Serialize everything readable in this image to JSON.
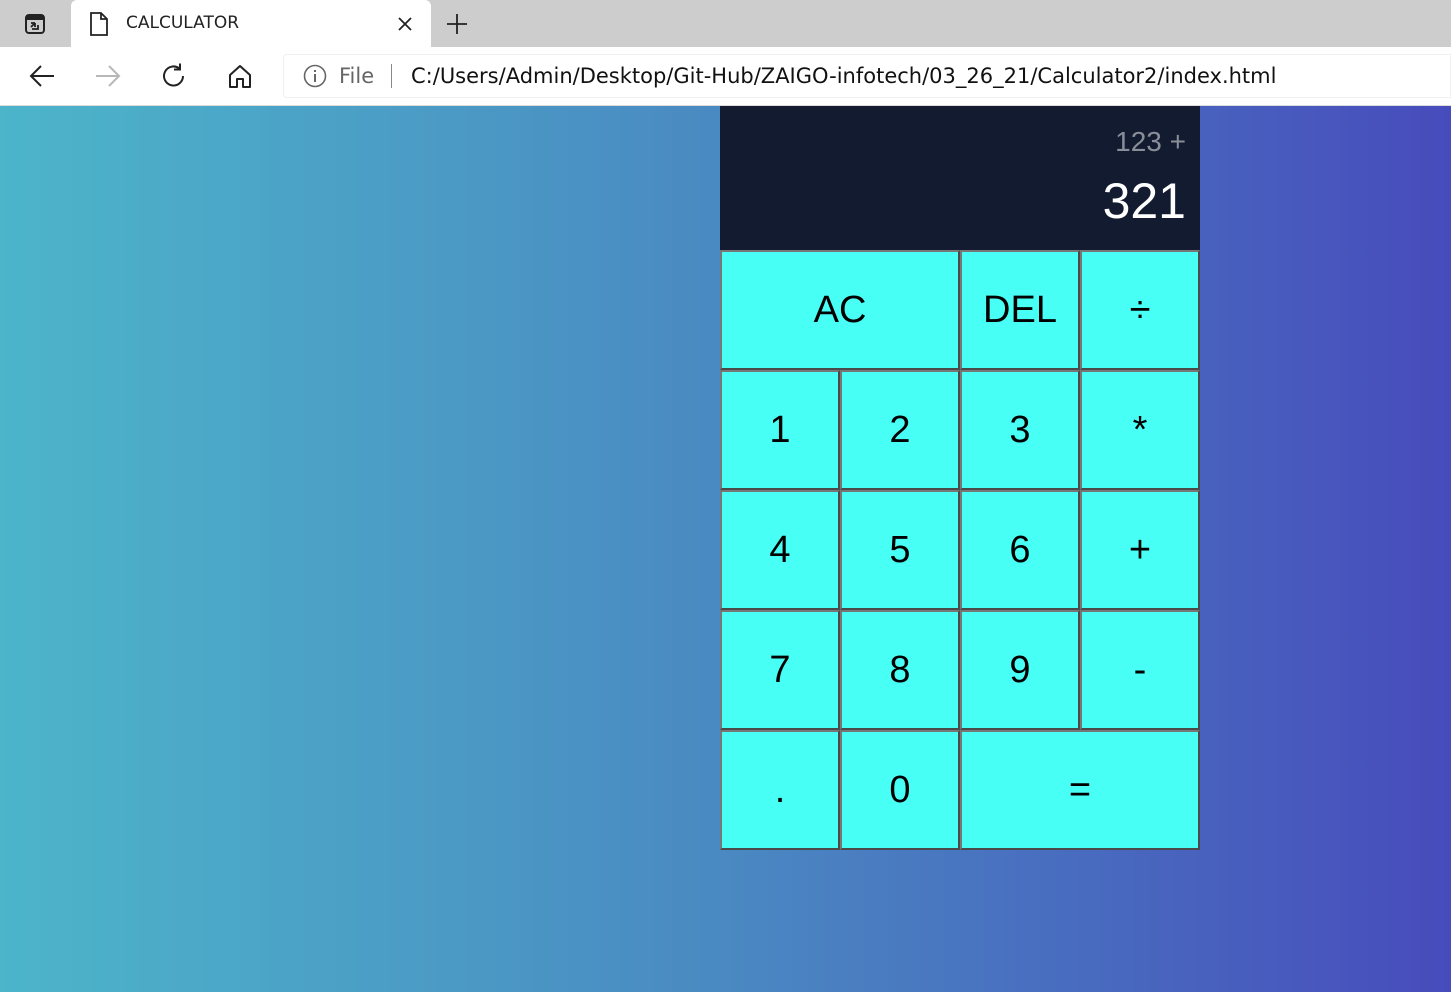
{
  "browser": {
    "tab": {
      "title": "CALCULATOR"
    },
    "address": {
      "scheme_label": "File",
      "url": "C:/Users/Admin/Desktop/Git-Hub/ZAIGO-infotech/03_26_21/Calculator2/index.html"
    }
  },
  "calculator": {
    "display": {
      "previous_operand": "123 +",
      "current_operand": "321"
    },
    "keys": {
      "all_clear": "AC",
      "delete": "DEL",
      "divide": "÷",
      "one": "1",
      "two": "2",
      "three": "3",
      "multiply": "*",
      "four": "4",
      "five": "5",
      "six": "6",
      "plus": "+",
      "seven": "7",
      "eight": "8",
      "nine": "9",
      "minus": "-",
      "decimal": ".",
      "zero": "0",
      "equals": "="
    }
  },
  "colors": {
    "page_gradient": [
      "#4cb5ca",
      "#474cbc"
    ],
    "display_bg": "#131b30",
    "key_bg": "#48fff5"
  },
  "icons": [
    "tab-actions-icon",
    "document-icon",
    "close-icon",
    "plus-icon",
    "back-arrow-icon",
    "forward-arrow-icon",
    "refresh-icon",
    "home-icon",
    "info-icon"
  ]
}
